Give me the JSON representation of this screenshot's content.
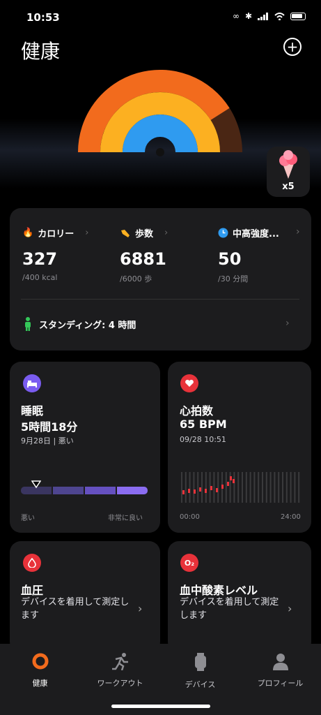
{
  "status": {
    "time": "10:53"
  },
  "header": {
    "title": "健康",
    "add_icon": "plus-circle-icon"
  },
  "rings": {
    "calories_pct": 0.82,
    "steps_pct": 1.0,
    "intensity_pct": 1.0,
    "colors": {
      "outer": "#f26b1d",
      "middle": "#fcb021",
      "inner": "#2f9bf0"
    }
  },
  "badge": {
    "count": "x5"
  },
  "activity": {
    "calories": {
      "label": "カロリー",
      "value": "327",
      "goal": "/400 kcal"
    },
    "steps": {
      "label": "歩数",
      "value": "6881",
      "goal": "/6000 歩"
    },
    "intensity": {
      "label": "中高強度...",
      "value": "50",
      "goal": "/30 分間"
    },
    "standing": "スタンディング: 4 時間"
  },
  "sleep": {
    "title": "睡眠",
    "duration": "5時間18分",
    "date_quality": "9月28日 | 悪い",
    "scale_low": "悪い",
    "scale_high": "非常に良い",
    "score_fraction": 0.12
  },
  "heart": {
    "title": "心拍数",
    "value": "65 BPM",
    "timestamp": "09/28 10:51",
    "x_start": "00:00",
    "x_end": "24:00"
  },
  "blood_pressure": {
    "title": "血圧",
    "desc": "デバイスを着用して測定します"
  },
  "spo2": {
    "title": "血中酸素レベル",
    "desc": "デバイスを着用して測定します"
  },
  "tabs": [
    {
      "label": "健康",
      "icon": "health-ring-icon",
      "active": true
    },
    {
      "label": "ワークアウト",
      "icon": "running-icon",
      "active": false
    },
    {
      "label": "デバイス",
      "icon": "watch-icon",
      "active": false
    },
    {
      "label": "プロフィール",
      "icon": "person-icon",
      "active": false
    }
  ]
}
